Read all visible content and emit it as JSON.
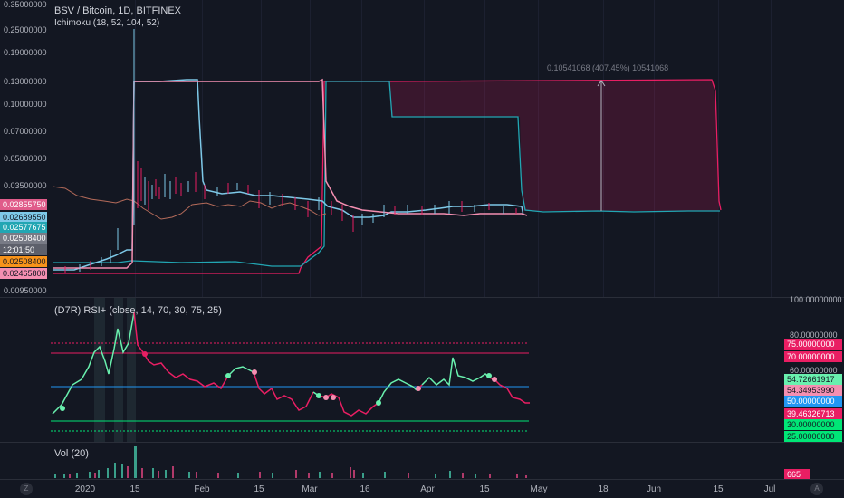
{
  "main": {
    "title": "BSV / Bitcoin, 1D, BITFINEX",
    "indicator": "Ichimoku (18, 52, 104, 52)",
    "measure_label": "0.10541068 (407.45%) 10541068",
    "price_axis": [
      "0.35000000",
      "0.25000000",
      "0.19000000",
      "0.13000000",
      "0.10000000",
      "0.07000000",
      "0.05000000",
      "0.03500000",
      "0.00950000"
    ],
    "left_tags": [
      {
        "text": "0.02855750",
        "bg": "#e05c8a",
        "fg": "#ffffff"
      },
      {
        "text": "0.02689550",
        "bg": "#7ec9e8",
        "fg": "#131722"
      },
      {
        "text": "0.02577675",
        "bg": "#22a6b3",
        "fg": "#ffffff"
      },
      {
        "text": "0.02508400",
        "bg": "#787b86",
        "fg": "#ffffff"
      },
      {
        "text": "12:01:50",
        "bg": "#5d606b",
        "fg": "#ffffff"
      },
      {
        "text": "0.02508400",
        "bg": "#f7931a",
        "fg": "#131722"
      },
      {
        "text": "0.02465800",
        "bg": "#f48fb1",
        "fg": "#131722"
      }
    ]
  },
  "rsi": {
    "title": "(D7R) RSI+ (close, 14, 70, 30, 75, 25)",
    "axis": [
      "100.00000000",
      "80.00000000",
      "60.00000000",
      "30.00000000",
      "25.00000000"
    ],
    "tags": [
      {
        "text": "75.00000000",
        "bg": "#e91e63",
        "fg": "#ffffff"
      },
      {
        "text": "70.00000000",
        "bg": "#e91e63",
        "fg": "#ffffff"
      },
      {
        "text": "54.72661917",
        "bg": "#69f0ae",
        "fg": "#131722"
      },
      {
        "text": "54.34953990",
        "bg": "#f48fb1",
        "fg": "#131722"
      },
      {
        "text": "50.00000000",
        "bg": "#2196f3",
        "fg": "#ffffff"
      },
      {
        "text": "39.46326713",
        "bg": "#e91e63",
        "fg": "#ffffff"
      },
      {
        "text": "30.00000000",
        "bg": "#00e676",
        "fg": "#131722"
      },
      {
        "text": "25.00000000",
        "bg": "#00e676",
        "fg": "#131722"
      }
    ]
  },
  "vol": {
    "title": "Vol (20)",
    "tag": {
      "text": "665",
      "bg": "#e91e63",
      "fg": "#ffffff"
    }
  },
  "time_axis": [
    "2020",
    "15",
    "Feb",
    "15",
    "Mar",
    "16",
    "Apr",
    "15",
    "May",
    "18",
    "Jun",
    "15",
    "Jul"
  ],
  "buttons": {
    "zoom": "Z",
    "auto": "A"
  },
  "colors": {
    "bg": "#131722",
    "tenkan": "#7ec9e8",
    "kijun": "#f48fb1",
    "chikou": "#b56b5a",
    "span": "#e91e63",
    "rsi_up": "#69f0ae",
    "rsi_down": "#e91e63"
  }
}
